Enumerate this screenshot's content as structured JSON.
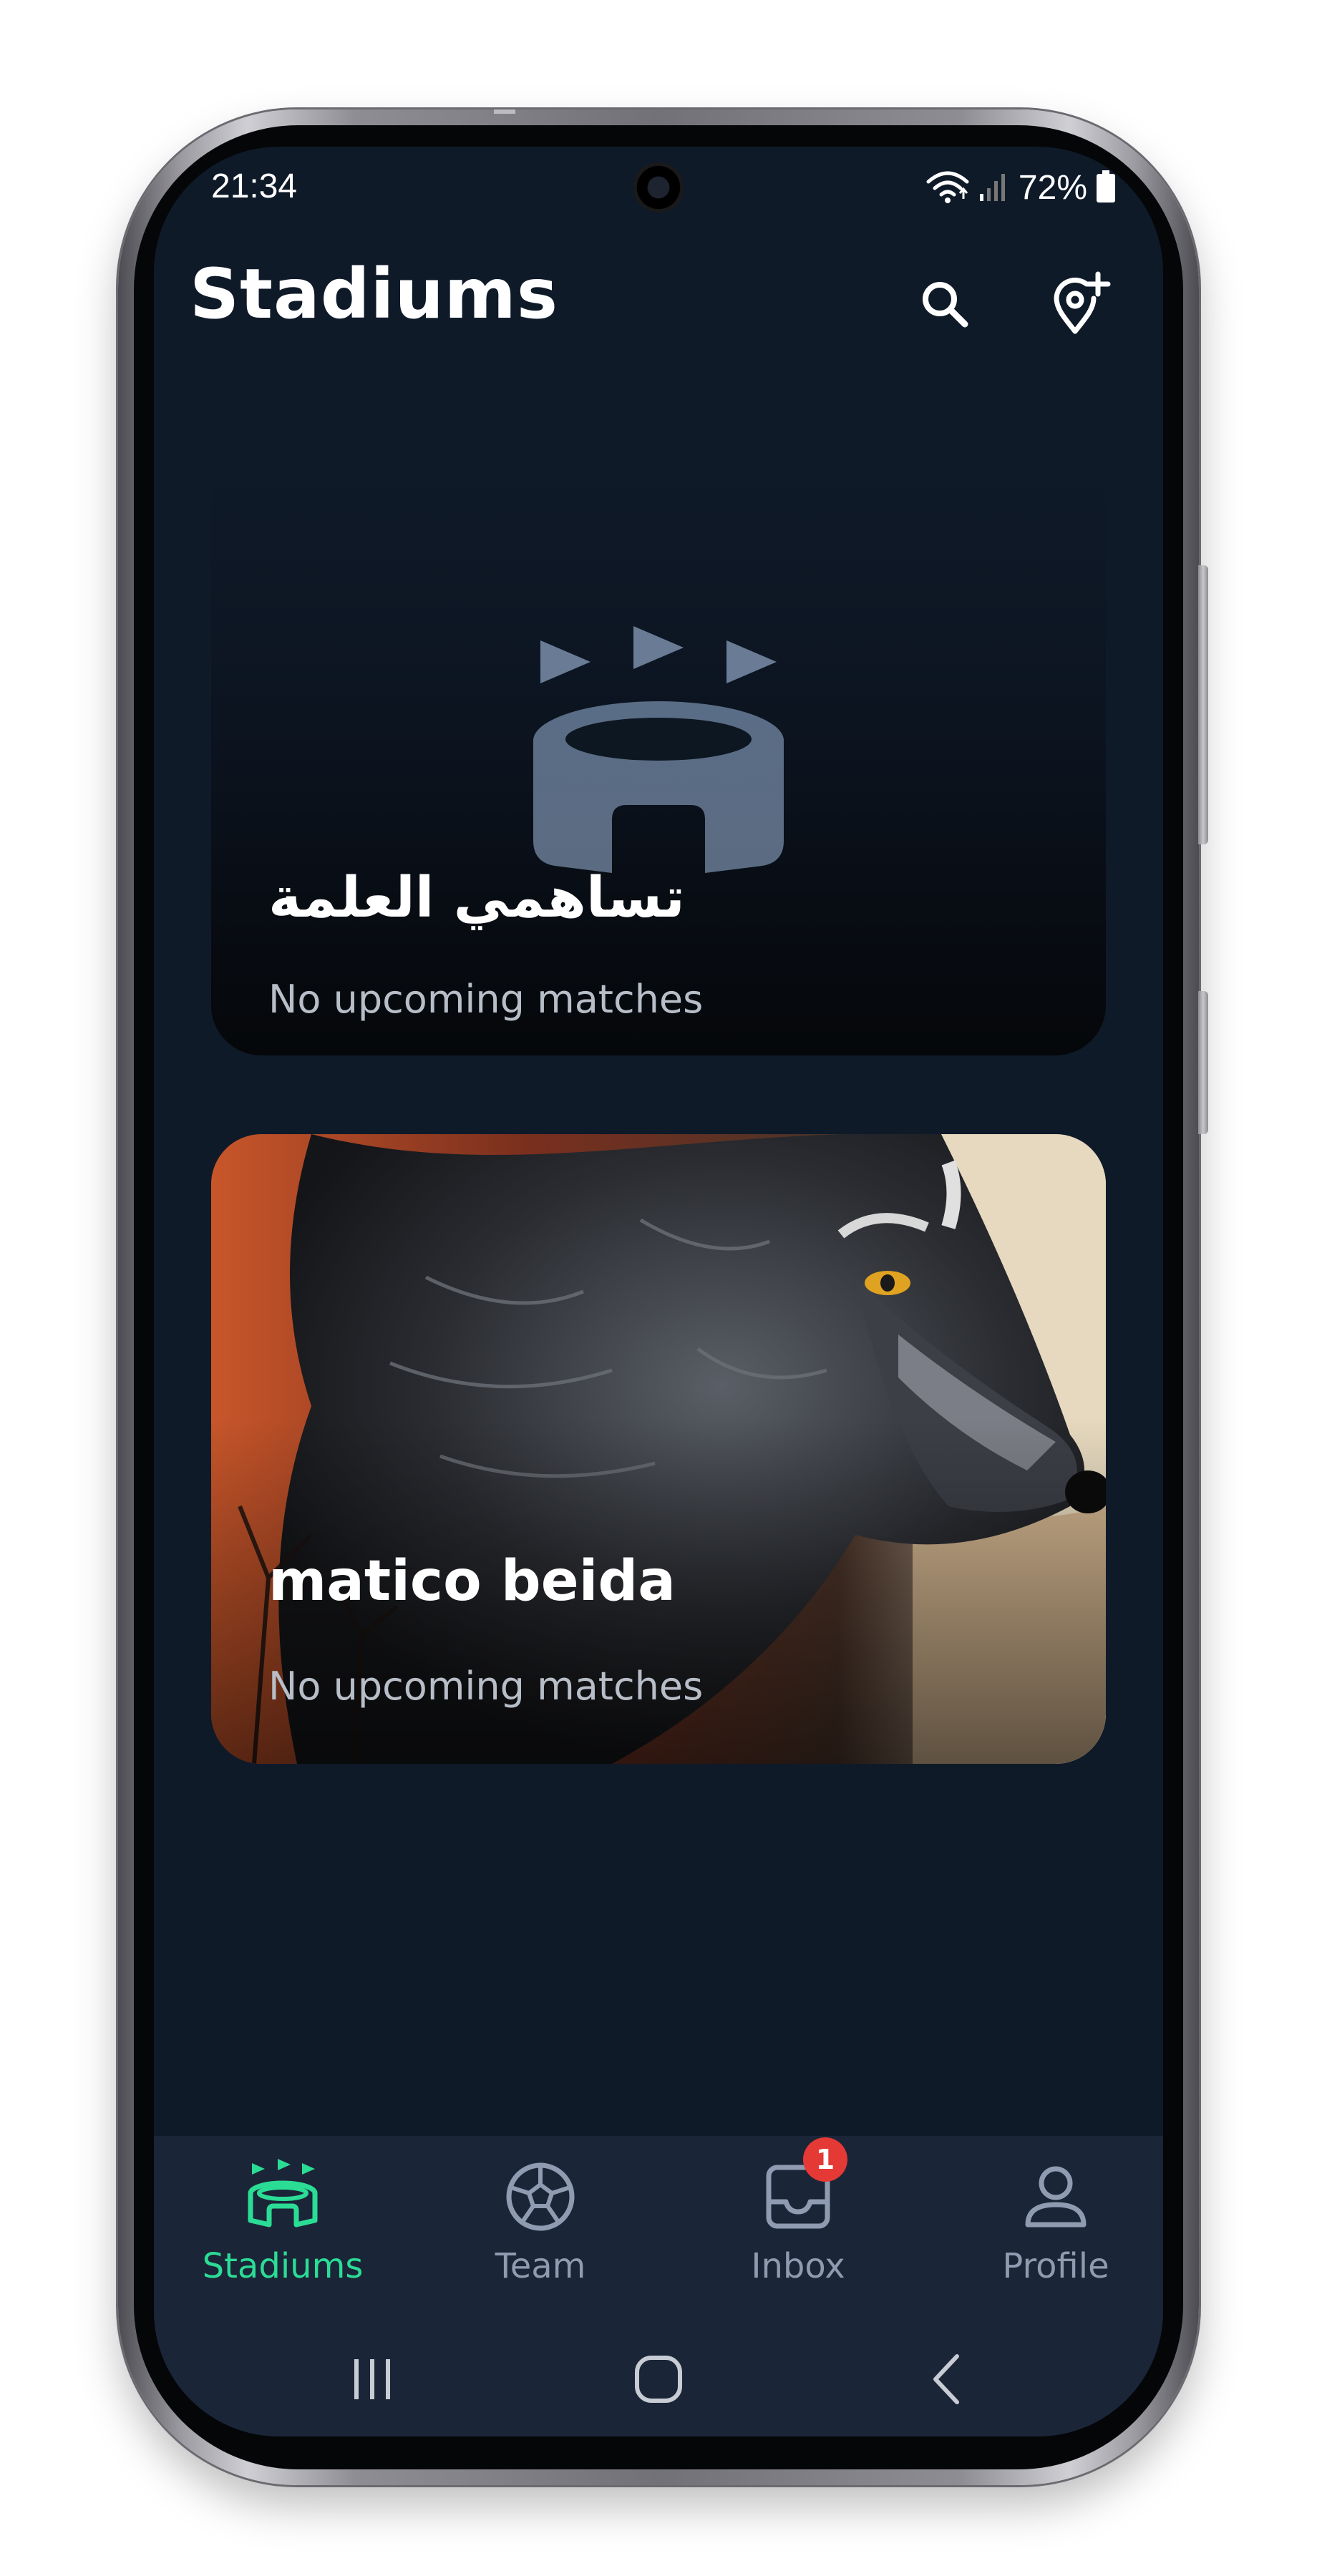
{
  "status_bar": {
    "time": "21:34",
    "battery": "72%",
    "icons": [
      "wifi-icon",
      "signal-icon",
      "battery-icon"
    ]
  },
  "header": {
    "title": "Stadiums",
    "actions": [
      {
        "name": "search-icon"
      },
      {
        "name": "add-location-icon"
      }
    ]
  },
  "stadiums": [
    {
      "name": "تساهمي العلمة",
      "subtitle": "No upcoming matches",
      "image": "stadium-placeholder-icon"
    },
    {
      "name": "matico beida",
      "subtitle": "No upcoming matches",
      "image": "wolf-image"
    }
  ],
  "bottom_nav": {
    "items": [
      {
        "label": "Stadiums",
        "icon": "stadium-icon",
        "active": true
      },
      {
        "label": "Team",
        "icon": "soccer-ball-icon",
        "active": false
      },
      {
        "label": "Inbox",
        "icon": "inbox-icon",
        "active": false,
        "badge": "1"
      },
      {
        "label": "Profile",
        "icon": "person-icon",
        "active": false
      }
    ]
  },
  "system_nav": {
    "buttons": [
      "recents-icon",
      "home-icon",
      "back-icon"
    ]
  },
  "colors": {
    "background": "#0f1a29",
    "nav_background": "#1b2538",
    "accent": "#2bdc95",
    "inactive": "#8f9bb0",
    "badge": "#e53935"
  }
}
